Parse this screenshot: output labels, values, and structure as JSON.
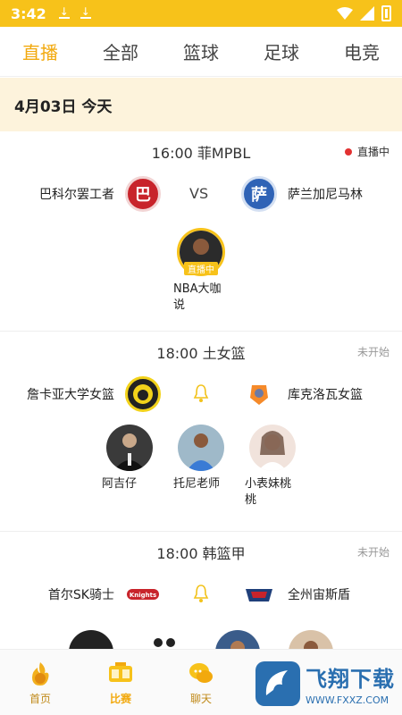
{
  "status_bar": {
    "time": "3:42"
  },
  "top_tabs": [
    {
      "label": "直播",
      "active": true
    },
    {
      "label": "全部",
      "active": false
    },
    {
      "label": "篮球",
      "active": false
    },
    {
      "label": "足球",
      "active": false
    },
    {
      "label": "电竞",
      "active": false
    }
  ],
  "date_header": "4月03日  今天",
  "matches": [
    {
      "time_league": "16:00 菲MPBL",
      "status": "直播中",
      "home": {
        "name": "巴科尔罢工者",
        "logo_text": "巴",
        "color": "#c8242b"
      },
      "vs": "VS",
      "away": {
        "name": "萨兰加尼马林",
        "logo_text": "萨",
        "color": "#2f63b6"
      },
      "streamers": [
        {
          "name": "NBA大咖说",
          "live_tag": "直播中"
        }
      ]
    },
    {
      "time_league": "18:00 土女篮",
      "status": "未开始",
      "home": {
        "name": "詹卡亚大学女篮"
      },
      "away": {
        "name": "库克洛瓦女篮"
      },
      "streamers": [
        {
          "name": "阿吉仔"
        },
        {
          "name": "托尼老师"
        },
        {
          "name": "小表妹桃桃"
        }
      ]
    },
    {
      "time_league": "18:00 韩篮甲",
      "status": "未开始",
      "home": {
        "name": "首尔SK骑士"
      },
      "away": {
        "name": "全州宙斯盾"
      }
    }
  ],
  "bottom_nav": [
    {
      "label": "首页",
      "icon": "basketball-flame-icon"
    },
    {
      "label": "比赛",
      "icon": "scoreboard-icon",
      "active": true
    },
    {
      "label": "聊天",
      "icon": "chat-bubbles-icon"
    }
  ],
  "watermark": {
    "title": "飞翔下载",
    "url": "WWW.FXXZ.COM"
  },
  "colors": {
    "accent": "#f7c21a",
    "active_tab": "#f2a90e",
    "date_bg": "#fdf3dc",
    "live_dot": "#e23131"
  }
}
